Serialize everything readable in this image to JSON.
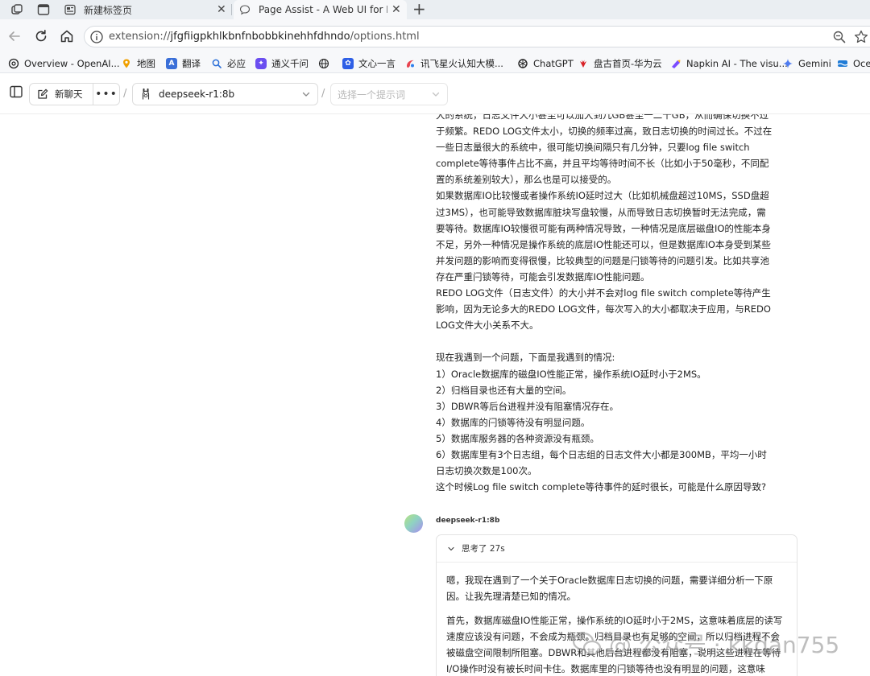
{
  "browser": {
    "tabs": [
      {
        "title": "新建标签页",
        "active": false
      },
      {
        "title": "Page Assist - A Web UI for Local A",
        "active": true
      }
    ],
    "new_tab_label": "+",
    "url_prefix": "extension://",
    "url_host": "jfgfiigpkhlkbnfnbobbkinehhfdhndo",
    "url_path": "/options.html"
  },
  "bookmarks": [
    {
      "label": "Overview - OpenAI...",
      "icon": "openai-icon"
    },
    {
      "label": "地图",
      "icon": "map-pin-icon"
    },
    {
      "label": "翻译",
      "icon": "translate-icon"
    },
    {
      "label": "必应",
      "icon": "search-icon"
    },
    {
      "label": "通义千问",
      "icon": "tongyi-icon"
    },
    {
      "label": "",
      "icon": "globe-icon"
    },
    {
      "label": "文心一言",
      "icon": "wenxin-icon"
    },
    {
      "label": "讯飞星火认知大模...",
      "icon": "xunfei-icon"
    },
    {
      "label": "ChatGPT",
      "icon": "chatgpt-icon"
    },
    {
      "label": "盘古首页-华为云",
      "icon": "huawei-icon"
    },
    {
      "label": "Napkin AI - The visu...",
      "icon": "napkin-icon"
    },
    {
      "label": "Gemini",
      "icon": "gemini-icon"
    },
    {
      "label": "Ocea",
      "icon": "ocean-icon"
    }
  ],
  "header": {
    "new_chat_label": "新聊天",
    "more_label": "•••",
    "separator": "/",
    "model": "deepseek-r1:8b",
    "prompt_placeholder": "选择一个提示词"
  },
  "user_message": {
    "paragraphs": [
      "大的系统，日志文件大小甚至可以加大到几GB甚至一二十GB，从而确保切换不过于频繁。REDO LOG文件太小，切换的频率过高，致日志切换的时间过长。不过在一些日志量很大的系统中，很可能切换间隔只有几分钟，只要log file switch complete等待事件占比不高，并且平均等待时间不长（比如小于50毫秒，不同配置的系统差别较大），那么也是可以接受的。",
      "如果数据库IO比较慢或者操作系统IO延时过大（比如机械盘超过10MS，SSD盘超过3MS），也可能导致数据库脏块写盘较慢，从而导致日志切换暂时无法完成，需要等待。数据库IO较慢很可能有两种情况导致，一种情况是底层磁盘IO的性能本身不足，另外一种情况是操作系统的底层IO性能还可以，但是数据库IO本身受到某些并发问题的影响而变得很慢，比较典型的问题是闩锁等待的问题引发。比如共享池存在严重闩锁等待，可能会引发数据库IO性能问题。",
      "REDO LOG文件（日志文件）的大小并不会对log file switch complete等待产生影响，因为无论多大的REDO LOG文件，每次写入的大小都取决于应用，与REDO LOG文件大小关系不大。",
      "",
      "现在我遇到一个问题，下面是我遇到的情况:",
      "1）Oracle数据库的磁盘IO性能正常，操作系统IO延时小于2MS。",
      "2）归档目录也还有大量的空间。",
      "3）DBWR等后台进程并没有阻塞情况存在。",
      "4）数据库的闩锁等待没有明显问题。",
      "5）数据库服务器的各种资源没有瓶颈。",
      "6）数据库里有3个日志组，每个日志组的日志文件大小都是300MB，平均一小时日志切换次数是100次。",
      "这个时候Log file switch complete等待事件的延时很长，可能是什么原因导致?"
    ]
  },
  "bot_message": {
    "name": "deepseek-r1:8b",
    "think_label": "思考了 27s",
    "think_paragraphs": [
      "嗯，我现在遇到了一个关于Oracle数据库日志切换的问题，需要详细分析一下原因。让我先理清楚已知的情况。",
      "首先，数据库磁盘IO性能正常，操作系统的IO延时小于2MS，这意味着底层的读写速度应该没有问题，不会成为瓶颈。归档目录也有足够的空间，所以归档进程不会被磁盘空间限制所阻塞。DBWR和其他后台进程都没有阻塞，说明这些进程在等待I/O操作时没有被长时间卡住。数据库里的闩锁等待也没有明显的问题，这意味"
    ]
  },
  "watermark": {
    "text": "@ 公众号 · kkdan755"
  }
}
